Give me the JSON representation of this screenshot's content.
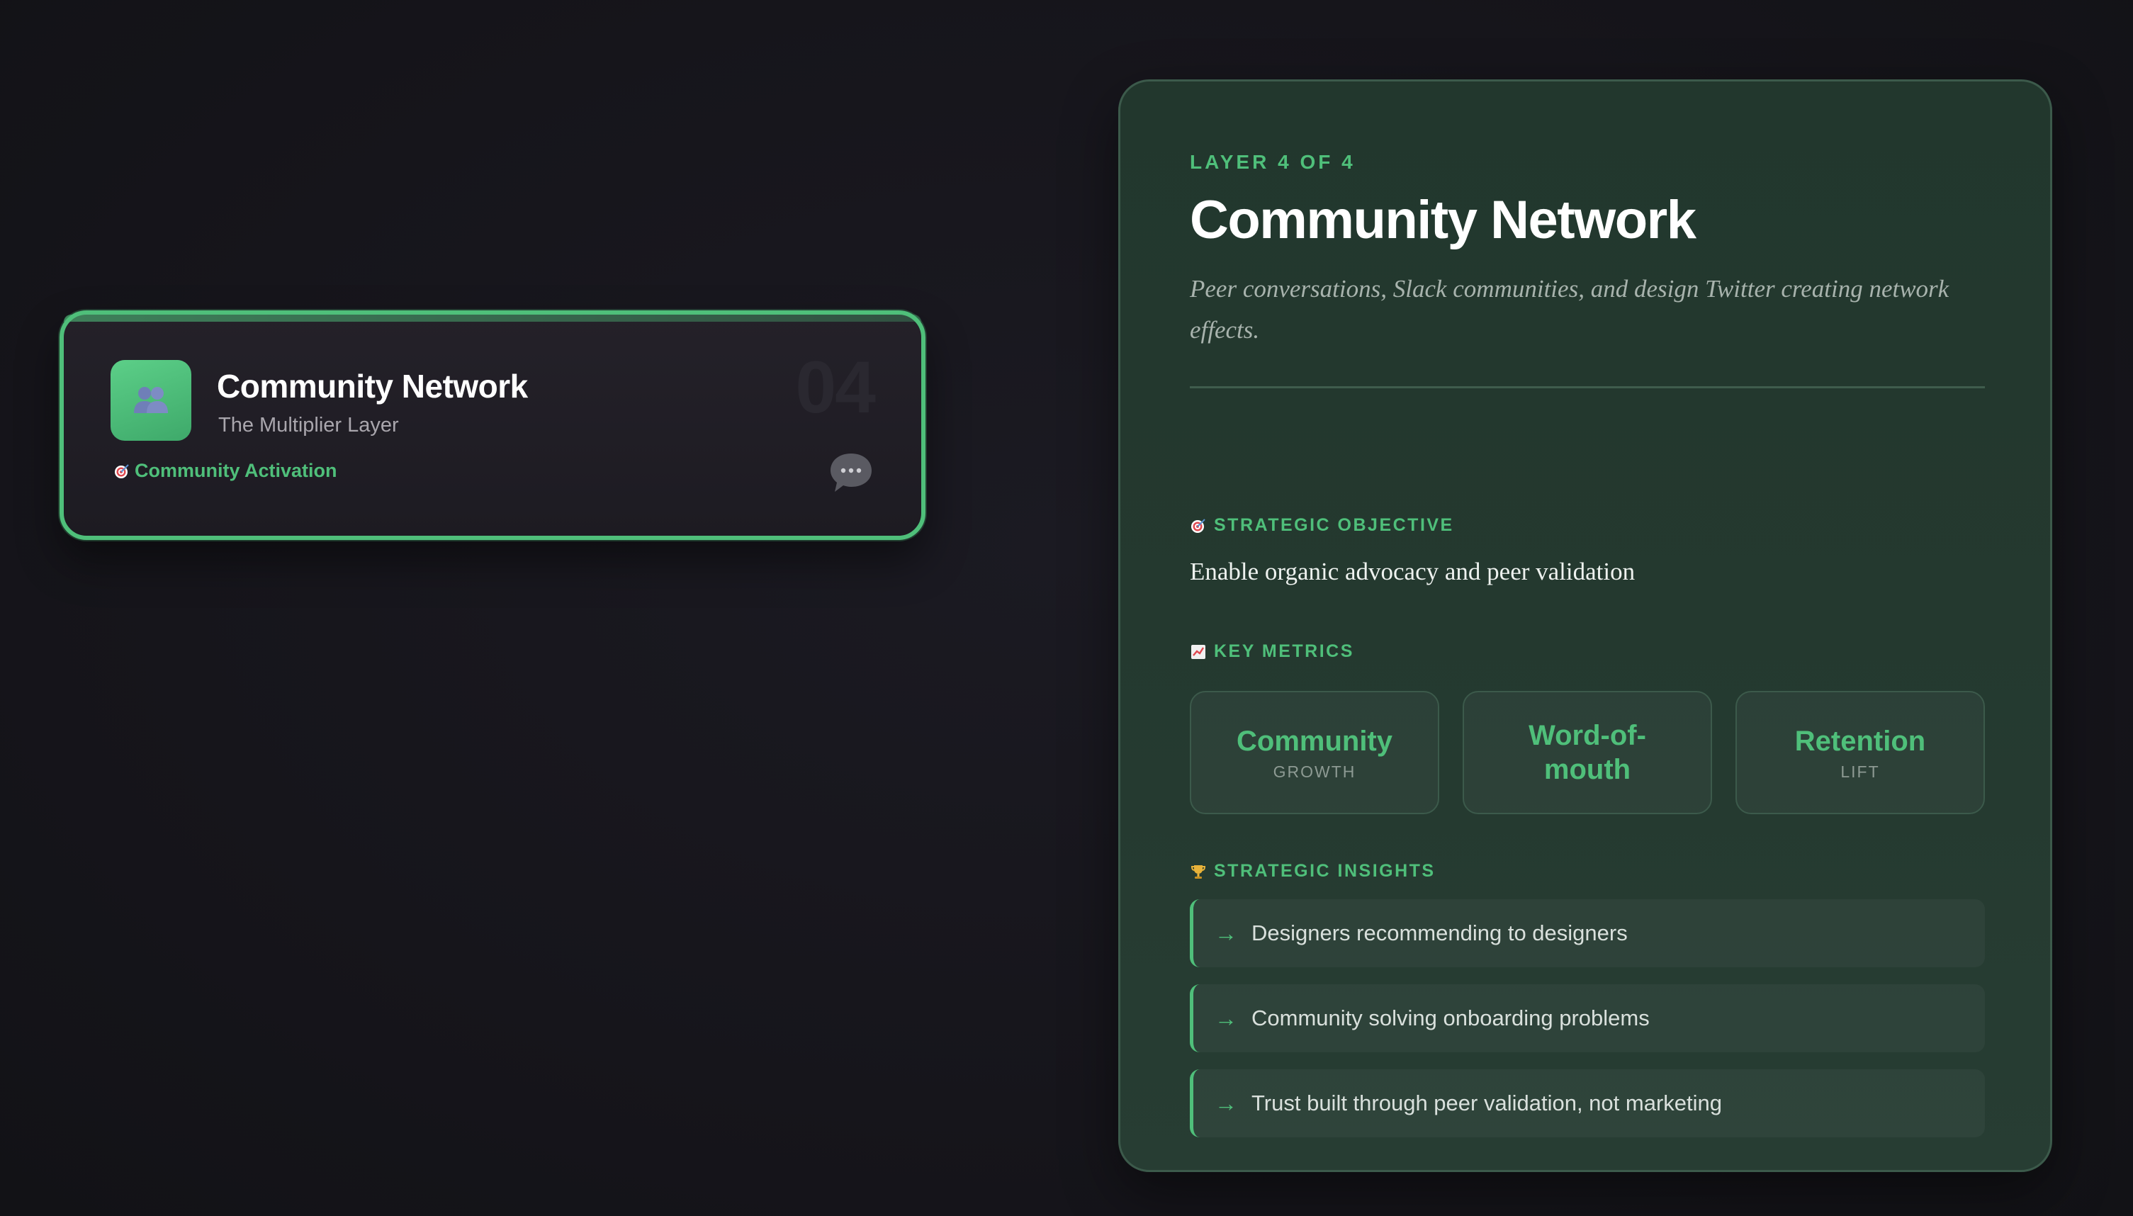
{
  "layer_card": {
    "title": "Community Network",
    "subtitle": "The Multiplier Layer",
    "number": "04",
    "tag": "Community Activation",
    "icon": "people-icon",
    "accent": "#4fbf7a"
  },
  "detail": {
    "layer_label": "LAYER 4 OF 4",
    "title": "Community Network",
    "description": "Peer conversations, Slack communities, and design Twitter creating network effects.",
    "objective_heading": "STRATEGIC OBJECTIVE",
    "objective": "Enable organic advocacy and peer validation",
    "metrics_heading": "KEY METRICS",
    "metrics": [
      {
        "value": "Community",
        "label": "GROWTH"
      },
      {
        "value": "Word-of-mouth",
        "label": ""
      },
      {
        "value": "Retention",
        "label": "LIFT"
      }
    ],
    "insights_heading": "STRATEGIC INSIGHTS",
    "insights": [
      {
        "arrow": "→",
        "text": "Designers recommending to designers"
      },
      {
        "arrow": "→",
        "text": "Community solving onboarding problems"
      },
      {
        "arrow": "→",
        "text": "Trust built through peer validation, not marketing"
      }
    ]
  },
  "colors": {
    "background": "#16151b",
    "panel": "#24392f",
    "accent": "#4fbf7a"
  }
}
